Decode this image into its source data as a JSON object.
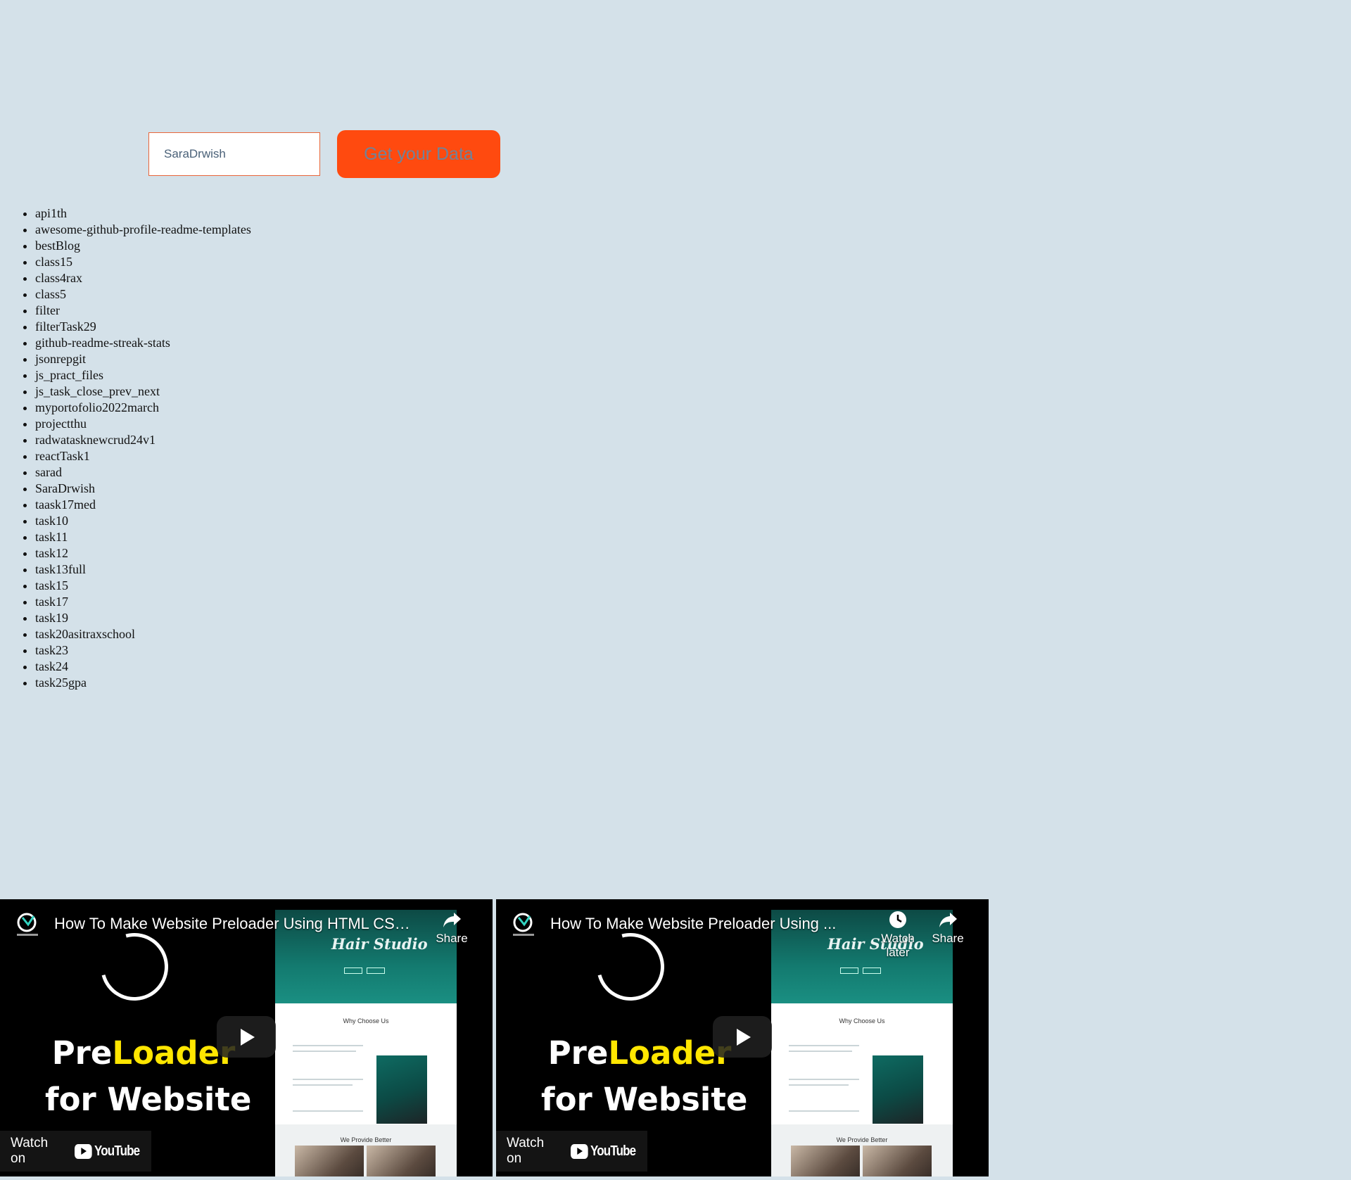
{
  "search": {
    "input_value": "SaraDrwish",
    "button_label": "Get your Data",
    "button_color": "#ff4a0f"
  },
  "repos": [
    "api1th",
    "awesome-github-profile-readme-templates",
    "bestBlog",
    "class15",
    "class4rax",
    "class5",
    "filter",
    "filterTask29",
    "github-readme-streak-stats",
    "jsonrepgit",
    "js_pract_files",
    "js_task_close_prev_next",
    "myportofolio2022march",
    "projectthu",
    "radwatasknewcrud24v1",
    "reactTask1",
    "sarad",
    "SaraDrwish",
    "taask17med",
    "task10",
    "task11",
    "task12",
    "task13full",
    "task15",
    "task17",
    "task19",
    "task20asitraxschool",
    "task23",
    "task24",
    "task25gpa"
  ],
  "videos": [
    {
      "title": "How To Make Website Preloader Using HTML CSS ...",
      "share_label": "Share",
      "watch_label": "Watch on",
      "youtube_label": "YouTube",
      "thumb_line1_a": "Pre",
      "thumb_line1_b": "Loader",
      "thumb_line2": "for Website",
      "shot_hero_title": "Hair Studio",
      "shot_section1": "Why Choose Us",
      "shot_section2": "We Provide Better"
    },
    {
      "title": "How To Make Website Preloader Using ...",
      "watch_later_label": "Watch later",
      "share_label": "Share",
      "watch_label": "Watch on",
      "youtube_label": "YouTube",
      "thumb_line1_a": "Pre",
      "thumb_line1_b": "Loader",
      "thumb_line2": "for Website",
      "shot_hero_title": "Hair Studio",
      "shot_section1": "Why Choose Us",
      "shot_section2": "We Provide Better"
    }
  ]
}
